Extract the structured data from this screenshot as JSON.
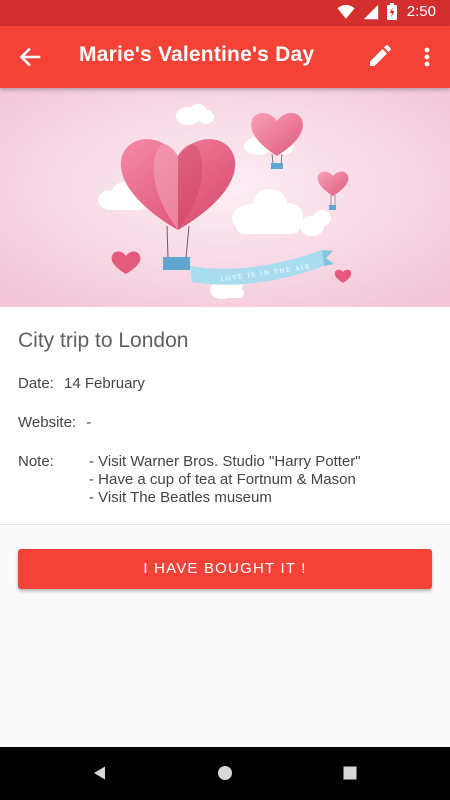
{
  "status_bar": {
    "time": "2:50",
    "icons": [
      "wifi-icon",
      "signal-icon",
      "battery-charging-icon"
    ],
    "color": "#d32f2f"
  },
  "app_bar": {
    "title": "Marie's Valentine's Day",
    "back_icon": "arrow-left-icon",
    "edit_icon": "pencil-icon",
    "more_icon": "more-vert-icon",
    "color": "#f44336"
  },
  "hero": {
    "description_icon": "heart-balloons-illustration",
    "banner_text": "LOVE IS IN THE AIR"
  },
  "offer": {
    "title": "City trip to London",
    "date_label": "Date:",
    "date_value": "14 February",
    "website_label": "Website:",
    "website_value": "-",
    "note_label": "Note:",
    "note_lines": [
      "- Visit Warner Bros. Studio \"Harry Potter\"",
      "- Have a cup of tea at Fortnum & Mason",
      "- Visit The Beatles museum"
    ]
  },
  "actions": {
    "bought_label": "I HAVE BOUGHT IT !"
  },
  "nav_bar": {
    "icons": [
      "back-triangle-icon",
      "home-circle-icon",
      "recents-square-icon"
    ]
  }
}
